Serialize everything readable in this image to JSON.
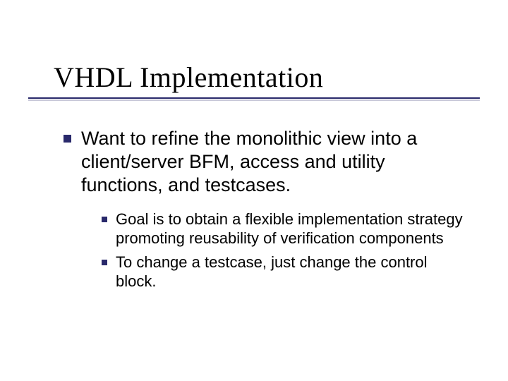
{
  "title": "VHDL Implementation",
  "bullets": {
    "main": "Want to refine the monolithic view into a client/server BFM, access and utility functions, and testcases.",
    "sub1": "Goal is to obtain a flexible implementation strategy promoting reusability of verification components",
    "sub2": "To change a testcase, just change the control block."
  }
}
